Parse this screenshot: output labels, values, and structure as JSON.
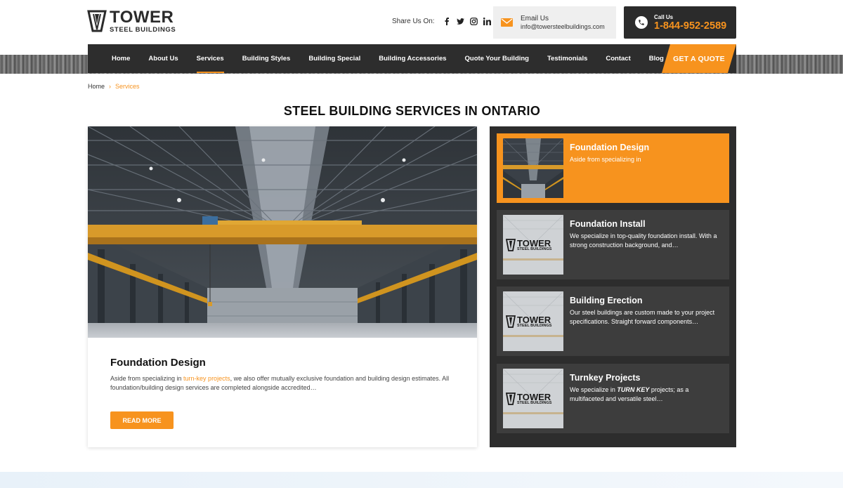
{
  "header": {
    "logo_line1": "TOWER",
    "logo_line2": "STEEL BUILDINGS",
    "share_label": "Share Us On:",
    "social_icons": [
      "facebook-icon",
      "twitter-icon",
      "instagram-icon",
      "linkedin-icon"
    ],
    "email_label": "Email Us",
    "email_value": "info@towersteelbuildings.com",
    "call_label": "Call Us",
    "call_value": "1-844-952-2589"
  },
  "nav": {
    "items": [
      "Home",
      "About Us",
      "Services",
      "Building Styles",
      "Building Special",
      "Building Accessories",
      "Quote Your Building",
      "Testimonials",
      "Contact",
      "Blog"
    ],
    "active": "Services",
    "quote_label": "GET A QUOTE"
  },
  "breadcrumb": {
    "home": "Home",
    "current": "Services"
  },
  "page_title": "STEEL BUILDING SERVICES IN ONTARIO",
  "main": {
    "title": "Foundation Design",
    "excerpt_before": "Aside from specializing in ",
    "excerpt_link": "turn-key projects",
    "excerpt_after": ", we also offer mutually exclusive foundation and building design estimates. All foundation/building design services are completed alongside accredited…",
    "read_more": "READ MORE"
  },
  "sidebar": {
    "items": [
      {
        "title": "Foundation Design",
        "desc": "Aside from specializing in"
      },
      {
        "title": "Foundation Install",
        "desc": "We specialize in top-quality foundation install. With a strong construction background, and…"
      },
      {
        "title": "Building Erection",
        "desc": "Our steel buildings are custom made to your project specifications. Straight forward components…"
      },
      {
        "title": "Turnkey Projects",
        "desc_before": "We specialize in ",
        "desc_em": "TURN KEY",
        "desc_after": " projects; as a multifaceted and versatile steel…"
      }
    ],
    "thumb_logo_line1": "TOWER",
    "thumb_logo_line2": "STEEL BUILDINGS"
  },
  "colors": {
    "accent": "#f7931e",
    "dark": "#2d2d2d",
    "card_dark": "#3d3d3d"
  }
}
